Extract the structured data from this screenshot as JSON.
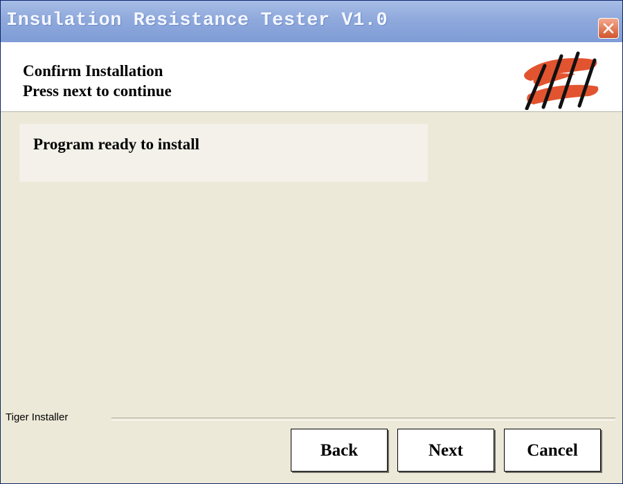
{
  "window": {
    "title": "Insulation Resistance Tester V1.0"
  },
  "header": {
    "heading": "Confirm Installation",
    "subheading": "Press next to continue",
    "logo_icon": "red-hatched-logo-icon"
  },
  "content": {
    "message": "Program ready to install"
  },
  "footer": {
    "installer_label": "Tiger Installer"
  },
  "buttons": {
    "back": "Back",
    "next": "Next",
    "cancel": "Cancel"
  },
  "colors": {
    "titlebar": "#8fa9dc",
    "close_button": "#d0562e",
    "logo": "#e2542f",
    "background": "#ece9d8"
  }
}
